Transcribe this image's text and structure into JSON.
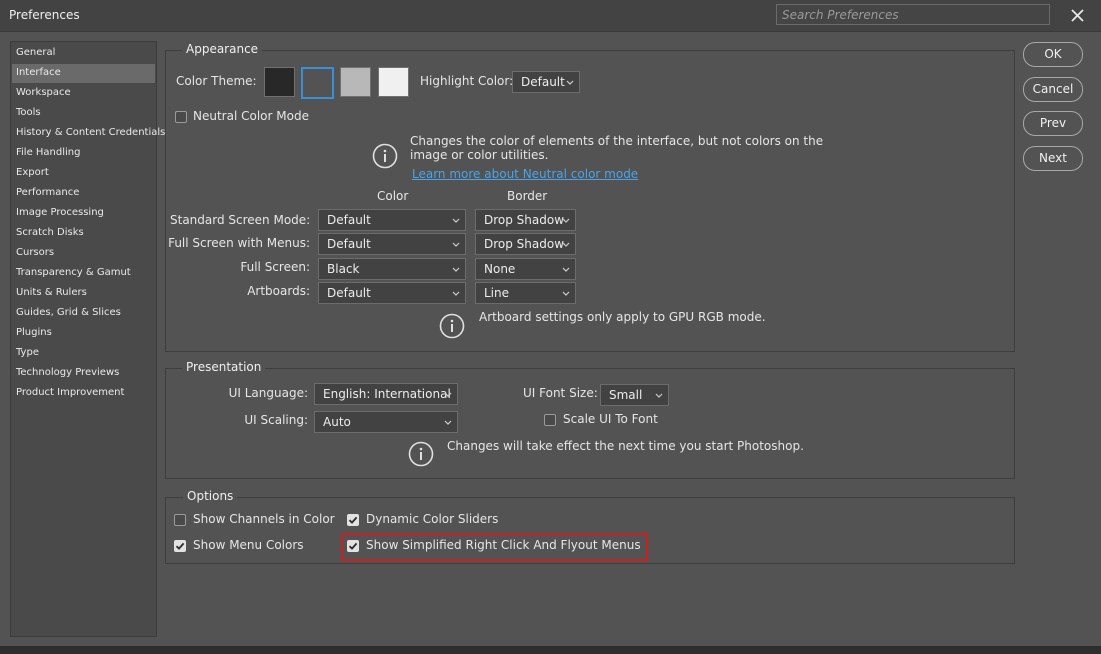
{
  "window": {
    "title": "Preferences",
    "search_placeholder": "Search Preferences"
  },
  "sidebar": {
    "items": [
      {
        "label": "General"
      },
      {
        "label": "Interface"
      },
      {
        "label": "Workspace"
      },
      {
        "label": "Tools"
      },
      {
        "label": "History & Content Credentials"
      },
      {
        "label": "File Handling"
      },
      {
        "label": "Export"
      },
      {
        "label": "Performance"
      },
      {
        "label": "Image Processing"
      },
      {
        "label": "Scratch Disks"
      },
      {
        "label": "Cursors"
      },
      {
        "label": "Transparency & Gamut"
      },
      {
        "label": "Units & Rulers"
      },
      {
        "label": "Guides, Grid & Slices"
      },
      {
        "label": "Plugins"
      },
      {
        "label": "Type"
      },
      {
        "label": "Technology Previews"
      },
      {
        "label": "Product Improvement"
      }
    ],
    "active": "Interface"
  },
  "buttons": {
    "ok": "OK",
    "cancel": "Cancel",
    "prev": "Prev",
    "next": "Next"
  },
  "appearance": {
    "legend": "Appearance",
    "color_theme_label": "Color Theme:",
    "theme_swatches": [
      "#282828",
      "#535353",
      "#b8b8b8",
      "#f0f0f0"
    ],
    "highlight_label": "Highlight Color:",
    "highlight_value": "Default",
    "neutral_label": "Neutral Color Mode",
    "neutral_info_line1": "Changes the color of elements of the interface, but not colors on the",
    "neutral_info_line2": "image or color utilities.",
    "neutral_link": "Learn more about Neutral color mode",
    "col_color": "Color",
    "col_border": "Border",
    "rows": [
      {
        "label": "Standard Screen Mode:",
        "color": "Default",
        "border": "Drop Shadow"
      },
      {
        "label": "Full Screen with Menus:",
        "color": "Default",
        "border": "Drop Shadow"
      },
      {
        "label": "Full Screen:",
        "color": "Black",
        "border": "None"
      },
      {
        "label": "Artboards:",
        "color": "Default",
        "border": "Line"
      }
    ],
    "artboard_info": "Artboard settings only apply to GPU RGB mode."
  },
  "presentation": {
    "legend": "Presentation",
    "ui_language_label": "UI Language:",
    "ui_language_value": "English: International",
    "ui_font_size_label": "UI Font Size:",
    "ui_font_size_value": "Small",
    "ui_scaling_label": "UI Scaling:",
    "ui_scaling_value": "Auto",
    "scale_ui_label": "Scale UI To Font",
    "info": "Changes will take effect the next time you start Photoshop."
  },
  "options": {
    "legend": "Options",
    "show_channels": "Show Channels in Color",
    "dynamic_sliders": "Dynamic Color Sliders",
    "show_menu_colors": "Show Menu Colors",
    "simplified_menus": "Show Simplified Right Click And Flyout Menus"
  },
  "colors": {
    "accent": "#3a8fd6",
    "highlight_box": "#cc1f1f",
    "link": "#4aa3ea"
  }
}
